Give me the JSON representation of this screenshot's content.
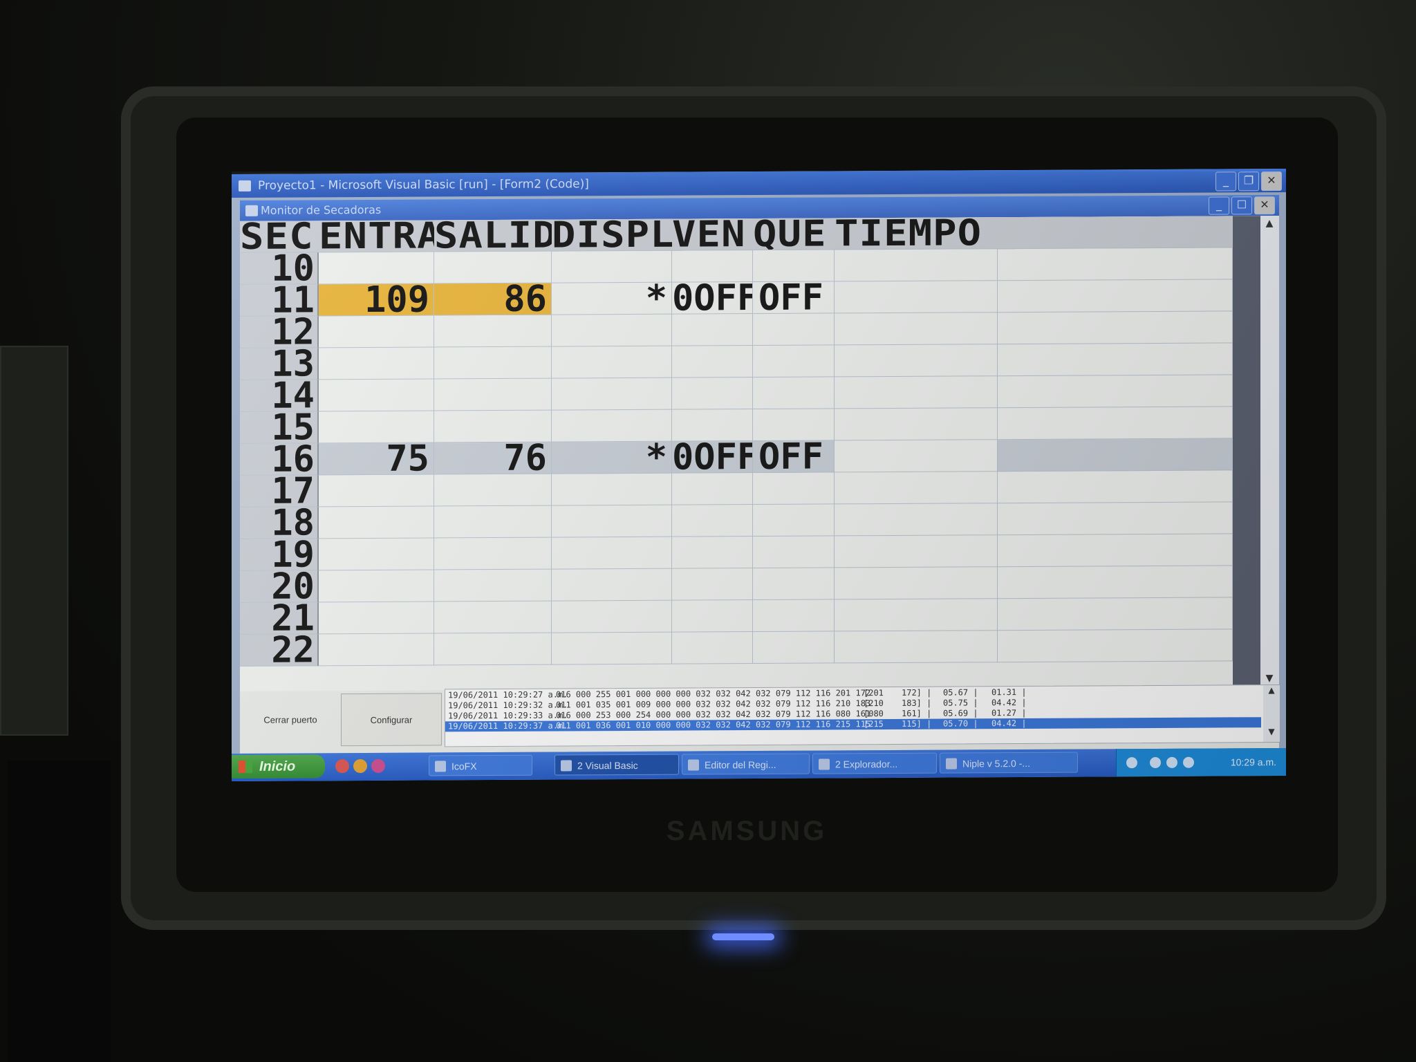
{
  "window": {
    "title": "Proyecto1 - Microsoft Visual Basic [run] - [Form2 (Code)]",
    "min": "_",
    "restore": "❐",
    "close": "✕"
  },
  "form": {
    "title": "Monitor de Secadoras",
    "min": "_",
    "max": "☐",
    "close": "✕"
  },
  "grid": {
    "headers": [
      "SEC",
      "ENTRA",
      "SALID",
      "DISPL",
      "VEN",
      "QUE",
      "TIEMPO"
    ],
    "rows": [
      {
        "sec": "10",
        "entra": "",
        "salid": "",
        "displ": "",
        "ven": "",
        "que": "",
        "tiempo": "",
        "highlight": ""
      },
      {
        "sec": "11",
        "entra": "109",
        "salid": "86",
        "displ": "*",
        "ven": "0OFF",
        "que": "OFF",
        "tiempo": "",
        "highlight": "orange"
      },
      {
        "sec": "12",
        "entra": "",
        "salid": "",
        "displ": "",
        "ven": "",
        "que": "",
        "tiempo": "",
        "highlight": ""
      },
      {
        "sec": "13",
        "entra": "",
        "salid": "",
        "displ": "",
        "ven": "",
        "que": "",
        "tiempo": "",
        "highlight": ""
      },
      {
        "sec": "14",
        "entra": "",
        "salid": "",
        "displ": "",
        "ven": "",
        "que": "",
        "tiempo": "",
        "highlight": ""
      },
      {
        "sec": "15",
        "entra": "",
        "salid": "",
        "displ": "",
        "ven": "",
        "que": "",
        "tiempo": "",
        "highlight": ""
      },
      {
        "sec": "16",
        "entra": "75",
        "salid": "76",
        "displ": "*",
        "ven": "0OFF",
        "que": "OFF",
        "tiempo": "",
        "highlight": "grey"
      },
      {
        "sec": "17",
        "entra": "",
        "salid": "",
        "displ": "",
        "ven": "",
        "que": "",
        "tiempo": "",
        "highlight": ""
      },
      {
        "sec": "18",
        "entra": "",
        "salid": "",
        "displ": "",
        "ven": "",
        "que": "",
        "tiempo": "",
        "highlight": ""
      },
      {
        "sec": "19",
        "entra": "",
        "salid": "",
        "displ": "",
        "ven": "",
        "que": "",
        "tiempo": "",
        "highlight": ""
      },
      {
        "sec": "20",
        "entra": "",
        "salid": "",
        "displ": "",
        "ven": "",
        "que": "",
        "tiempo": "",
        "highlight": ""
      },
      {
        "sec": "21",
        "entra": "",
        "salid": "",
        "displ": "",
        "ven": "",
        "que": "",
        "tiempo": "",
        "highlight": ""
      },
      {
        "sec": "22",
        "entra": "",
        "salid": "",
        "displ": "",
        "ven": "",
        "que": "",
        "tiempo": "",
        "highlight": ""
      }
    ]
  },
  "buttons": {
    "close_port": "Cerrar puerto",
    "configure": "Configurar"
  },
  "log": {
    "rows": [
      {
        "time": "19/06/2011 10:29:27 a.m.",
        "bytes": "016 000 255 001 000 000 000 032 032 042 032 079 112 116 201 172",
        "a": "[201",
        "b": "172] |",
        "c": "05.67 |",
        "d": "01.31 |",
        "selected": false
      },
      {
        "time": "19/06/2011 10:29:32 a.m.",
        "bytes": "011 001 035 001 009 000 000 032 032 042 032 079 112 116 210 183",
        "a": "[210",
        "b": "183] |",
        "c": "05.75 |",
        "d": "04.42 |",
        "selected": false
      },
      {
        "time": "19/06/2011 10:29:33 a.m.",
        "bytes": "016 000 253 000 254 000 000 032 032 042 032 079 112 116 080 161",
        "a": "[080",
        "b": "161] |",
        "c": "05.69 |",
        "d": "01.27 |",
        "selected": false
      },
      {
        "time": "19/06/2011 10:29:37 a.m.",
        "bytes": "011 001 036 001 010 000 000 032 032 042 032 079 112 116 215 115",
        "a": "[215",
        "b": "115] |",
        "c": "05.70 |",
        "d": "04.42 |",
        "selected": true
      }
    ]
  },
  "taskbar": {
    "start": "Inicio",
    "tasks": [
      "IcoFX",
      "2 Visual Basic",
      "Editor del Regi...",
      "2 Explorador...",
      "Niple v 5.2.0 -..."
    ],
    "clock": "10:29 a.m."
  },
  "monitor_brand": "SAMSUNG",
  "colors": {
    "highlight_orange": "#e9b53c",
    "highlight_grey": "#c8ced6",
    "selected_log": "#3a76d8"
  }
}
